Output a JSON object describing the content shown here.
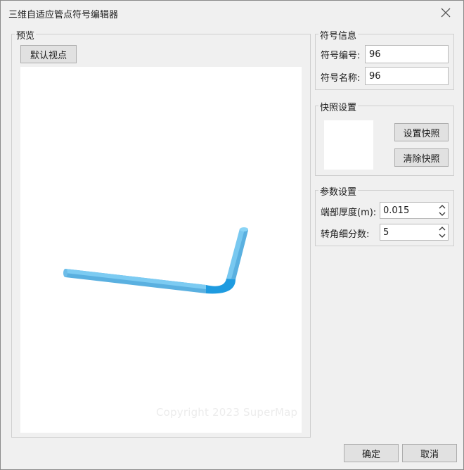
{
  "window": {
    "title": "三维自适应管点符号编辑器"
  },
  "preview": {
    "legend": "预览",
    "default_view_label": "默认视点",
    "watermark": "Copyright 2023 SuperMap"
  },
  "symbol_info": {
    "legend": "符号信息",
    "id_label": "符号编号:",
    "id_value": "96",
    "name_label": "符号名称:",
    "name_value": "96"
  },
  "snapshot": {
    "legend": "快照设置",
    "set_label": "设置快照",
    "clear_label": "清除快照"
  },
  "params": {
    "legend": "参数设置",
    "end_thickness_label": "端部厚度(m):",
    "end_thickness_value": "0.015",
    "corner_subdiv_label": "转角细分数:",
    "corner_subdiv_value": "5"
  },
  "footer": {
    "ok_label": "确定",
    "cancel_label": "取消"
  },
  "colors": {
    "pipe": "#78c8f0",
    "pipe_shadow": "#4aa6d8",
    "elbow": "#1e9be0"
  }
}
